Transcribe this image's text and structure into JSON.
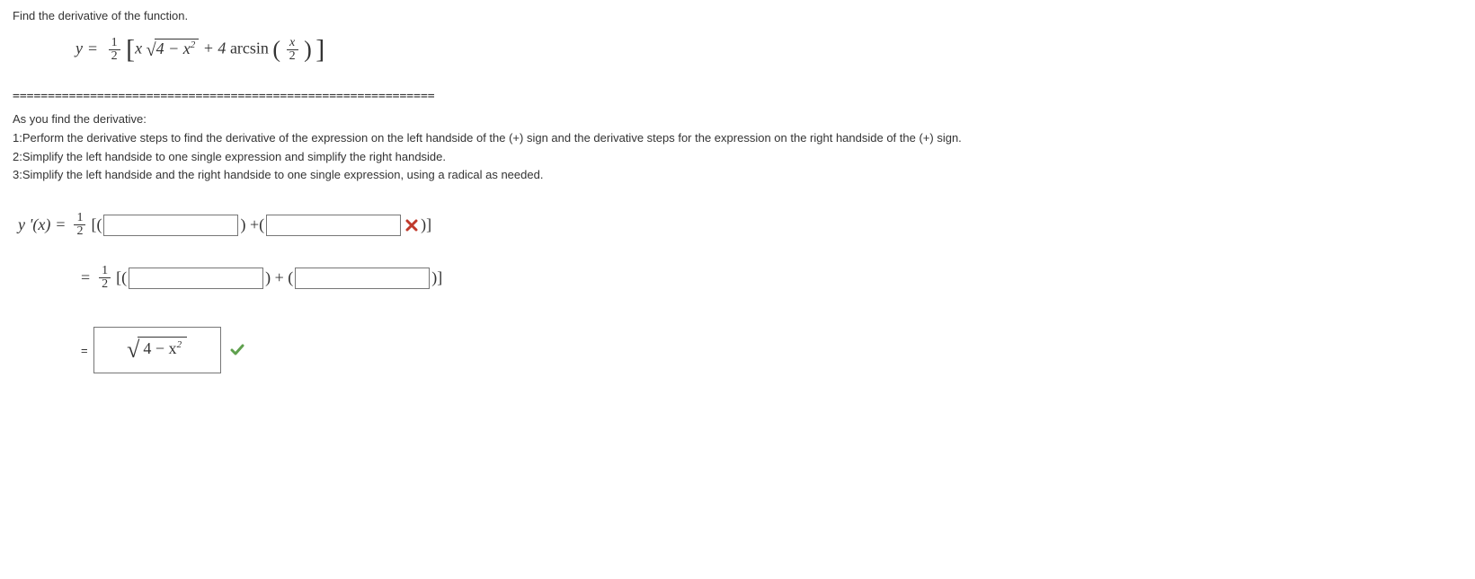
{
  "prompt": "Find the derivative of the function.",
  "formula": {
    "half_num": "1",
    "half_den": "2",
    "x1": "x",
    "radicand": "4 − x",
    "radicand_sup": "2",
    "plus4": " + 4 ",
    "arcsin": "arcsin",
    "arg_num": "x",
    "arg_den": "2"
  },
  "separator": "============================================================",
  "instr_head": "As you find the derivative:",
  "instr_1": "1:Perform the derivative steps to find the derivative of the expression on the left handside of the (+) sign and the derivative steps for the expression on the right handside of the (+) sign.",
  "instr_2": "2:Simplify the left handside to one single expression and simplify the right handside.",
  "instr_3": "3:Simplify the left handside and the right handside to one single expression, using a radical as needed.",
  "row1": {
    "lead": "y '(x) ",
    "half_num": "1",
    "half_den": "2",
    "open": " [(",
    "mid": ") +(",
    "close": ")]"
  },
  "row2": {
    "eq": "= ",
    "half_num": "1",
    "half_den": "2",
    "open": " [(",
    "mid": ") + (",
    "close": ")]"
  },
  "final": {
    "eq": "= ",
    "radicand": "4 − x",
    "sup": "2"
  }
}
